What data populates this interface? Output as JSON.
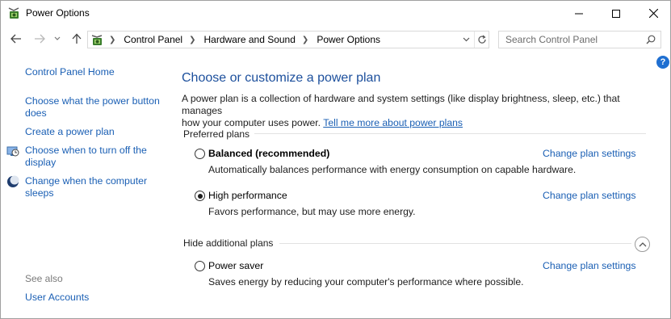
{
  "window": {
    "title": "Power Options"
  },
  "address_bar": {
    "crumbs": [
      "Control Panel",
      "Hardware and Sound",
      "Power Options"
    ]
  },
  "search": {
    "placeholder": "Search Control Panel"
  },
  "left_pane": {
    "home": "Control Panel Home",
    "links": [
      {
        "line1": "Choose what the power button",
        "line2": "does"
      },
      {
        "line1": "Create a power plan",
        "line2": ""
      },
      {
        "line1": "Choose when to turn off the",
        "line2": "display",
        "icon": "display-clock-icon"
      },
      {
        "line1": "Change when the computer",
        "line2": "sleeps",
        "icon": "sleep-moon-icon"
      }
    ],
    "see_also_label": "See also",
    "see_also_links": [
      "User Accounts"
    ]
  },
  "main": {
    "heading": "Choose or customize a power plan",
    "intro_line1": "A power plan is a collection of hardware and system settings (like display brightness, sleep, etc.) that manages",
    "intro_line2": "how your computer uses power.",
    "intro_link": "Tell me more about power plans",
    "preferred_label": "Preferred plans",
    "hidden_label": "Hide additional plans",
    "plans": [
      {
        "name": "Balanced (recommended)",
        "desc": "Automatically balances performance with energy consumption on capable hardware.",
        "selected": false,
        "link": "Change plan settings"
      },
      {
        "name": "High performance",
        "desc": "Favors performance, but may use more energy.",
        "selected": true,
        "link": "Change plan settings"
      },
      {
        "name": "Power saver",
        "desc": "Saves energy by reducing your computer's performance where possible.",
        "selected": false,
        "link": "Change plan settings"
      }
    ]
  },
  "colors": {
    "link": "#1a5fb4",
    "heading": "#1c4f9c",
    "help": "#1f6fd1"
  }
}
